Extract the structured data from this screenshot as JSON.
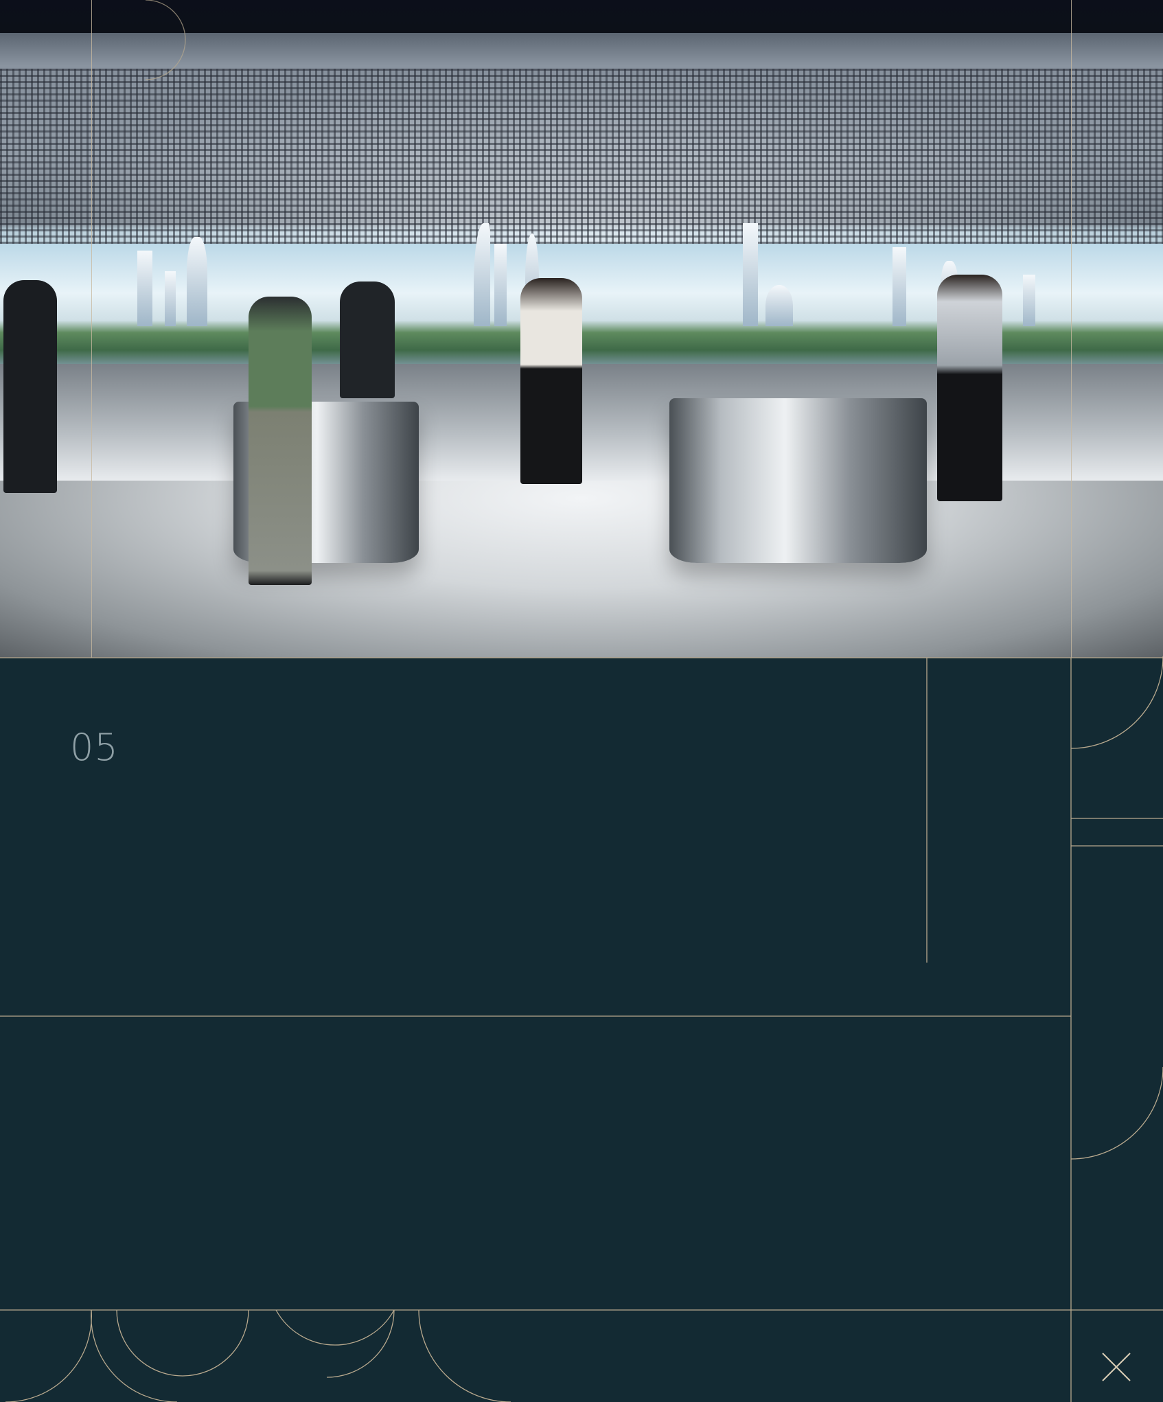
{
  "slide": {
    "number": "05"
  },
  "hero_image": {
    "subject": "exhibition-hall-render"
  },
  "controls": {
    "close_icon": "close-icon"
  },
  "colors": {
    "background": "#132a33",
    "frame_line": "#b8a98e",
    "number_text": "#8fa0a6"
  }
}
